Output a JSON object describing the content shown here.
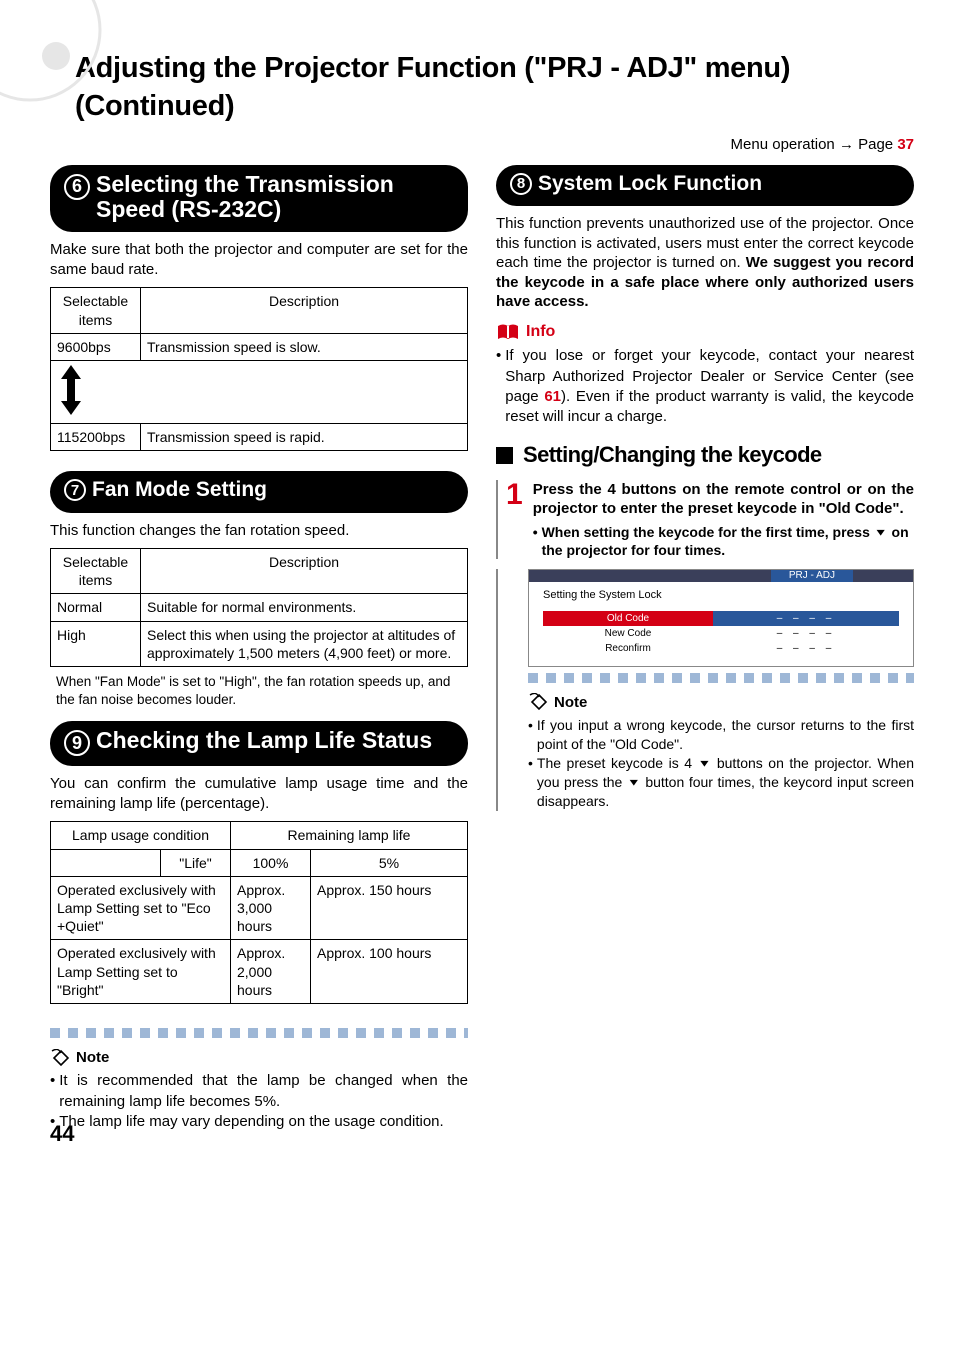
{
  "header": {
    "title": "Adjusting the Projector Function (\"PRJ - ADJ\" menu)  (Continued)",
    "menu_op_prefix": "Menu operation ",
    "menu_op_page_word": "Page ",
    "menu_op_page": "37"
  },
  "left": {
    "s6": {
      "num": "6",
      "title": "Selecting the Transmission Speed (RS-232C)",
      "intro": "Make sure that both the projector and computer are set for the same baud rate.",
      "table": {
        "h1": "Selectable items",
        "h2": "Description",
        "r1c1": "9600bps",
        "r1c2": "Transmission speed is slow.",
        "r2c1": "115200bps",
        "r2c2": "Transmission speed is rapid."
      }
    },
    "s7": {
      "num": "7",
      "title": "Fan Mode Setting",
      "intro": "This function changes the fan rotation speed.",
      "table": {
        "h1": "Selectable items",
        "h2": "Description",
        "r1c1": "Normal",
        "r1c2": "Suitable for normal environments.",
        "r2c1": "High",
        "r2c2": "Select this when using the projector at altitudes of approximately 1,500 meters (4,900 feet) or more."
      },
      "note": "When \"Fan Mode\" is set to \"High\", the fan rotation speeds up, and the fan noise becomes louder."
    },
    "s9": {
      "num": "9",
      "title": "Checking the Lamp Life Status",
      "intro": "You can confirm the cumulative lamp usage time and the remaining lamp life (percentage).",
      "table": {
        "h1": "Lamp usage condition",
        "h2": "Remaining lamp life",
        "sub1": "\"Life\"",
        "sub2": "100%",
        "sub3": "5%",
        "r1c1": "Operated exclusively with Lamp Setting set to \"Eco +Quiet\"",
        "r1c2": "Approx. 3,000 hours",
        "r1c3": "Approx. 150 hours",
        "r2c1": "Operated exclusively with Lamp Setting set to \"Bright\"",
        "r2c2": "Approx. 2,000 hours",
        "r2c3": "Approx. 100 hours"
      },
      "note_label": "Note",
      "note_b1": "It is recommended that the lamp be changed when the remaining lamp life becomes 5%.",
      "note_b2": "The lamp life may vary depending on the usage condition."
    }
  },
  "right": {
    "s8": {
      "num": "8",
      "title": "System Lock Function",
      "intro_a": "This function prevents unauthorized use of the projector. Once this function is activated, users must enter the correct keycode each time the projector is turned on. ",
      "intro_b": "We suggest you record the keycode in a safe place where only authorized users have access.",
      "info_label": "Info",
      "info_b1a": "If you lose or forget your keycode, contact your nearest Sharp Authorized Projector Dealer or Service Center (see page ",
      "info_page": "61",
      "info_b1b": "). Even if the product warranty is valid, the keycode reset will incur a charge.",
      "subheading": "Setting/Changing the keycode",
      "step1_num": "1",
      "step1_text": "Press the 4 buttons on the remote control or on the projector to enter the preset keycode in \"Old Code\".",
      "step1_sub_a": "When setting the keycode for the first time, press ",
      "step1_sub_b": " on the projector for four times.",
      "osd": {
        "prj": "PRJ - ADJ",
        "title": "Setting the System Lock",
        "old_l": "Old Code",
        "old_v": "– – – –",
        "new_l": "New Code",
        "new_v": "– – – –",
        "rec_l": "Reconfirm",
        "rec_v": "– – – –"
      },
      "note_label": "Note",
      "note_b1": "If you input a wrong keycode, the cursor returns to the first point of the \"Old Code\".",
      "note_b2a": "The preset keycode is 4 ",
      "note_b2b": " buttons on the projector. When you press the ",
      "note_b2c": " button four times, the keycord input screen disappears."
    }
  },
  "page_number": "44"
}
